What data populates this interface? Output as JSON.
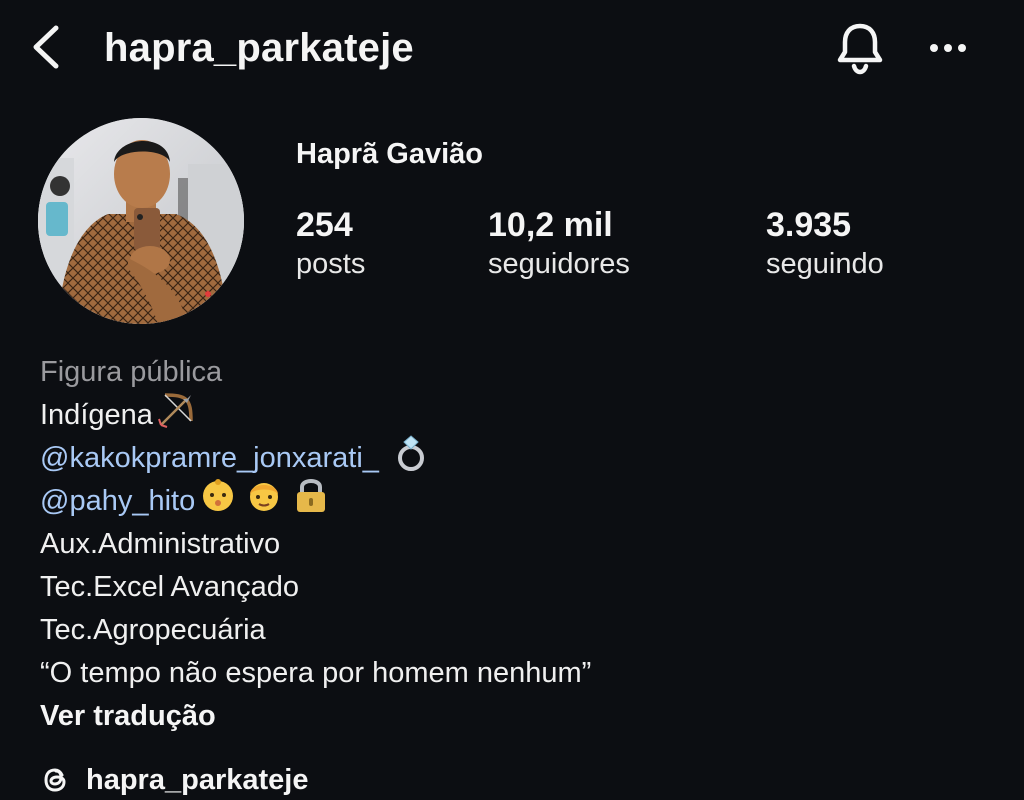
{
  "header": {
    "username": "hapra_parkateje",
    "back_icon": "chevron-left-icon",
    "bell_icon": "bell-icon",
    "more_icon": "more-horizontal-icon"
  },
  "profile": {
    "full_name": "Haprã Gavião",
    "stats": {
      "posts_value": "254",
      "posts_label": "posts",
      "followers_value": "10,2 mil",
      "followers_label": "seguidores",
      "following_value": "3.935",
      "following_label": "seguindo"
    }
  },
  "bio": {
    "category": "Figura pública",
    "line1": "Indígena",
    "line1_emoji": "bow-and-arrow-icon",
    "mention1": "@kakokpramre_jonxarati_",
    "mention1_emoji": "ring-icon",
    "mention2": "@pahy_hito",
    "mention2_emojis": [
      "baby-icon",
      "boy-icon",
      "lock-icon"
    ],
    "line4": "Aux.Administrativo",
    "line5": "Tec.Excel Avançado",
    "line6": "Tec.Agropecuária",
    "quote": "“O tempo não espera por homem nenhum”",
    "translate_label": "Ver tradução"
  },
  "threads": {
    "icon": "threads-icon",
    "handle": "hapra_parkateje"
  },
  "colors": {
    "background": "#0c0e12",
    "text_primary": "#f5f5f5",
    "text_secondary": "#9a9a9e",
    "mention": "#a9c9f5"
  }
}
